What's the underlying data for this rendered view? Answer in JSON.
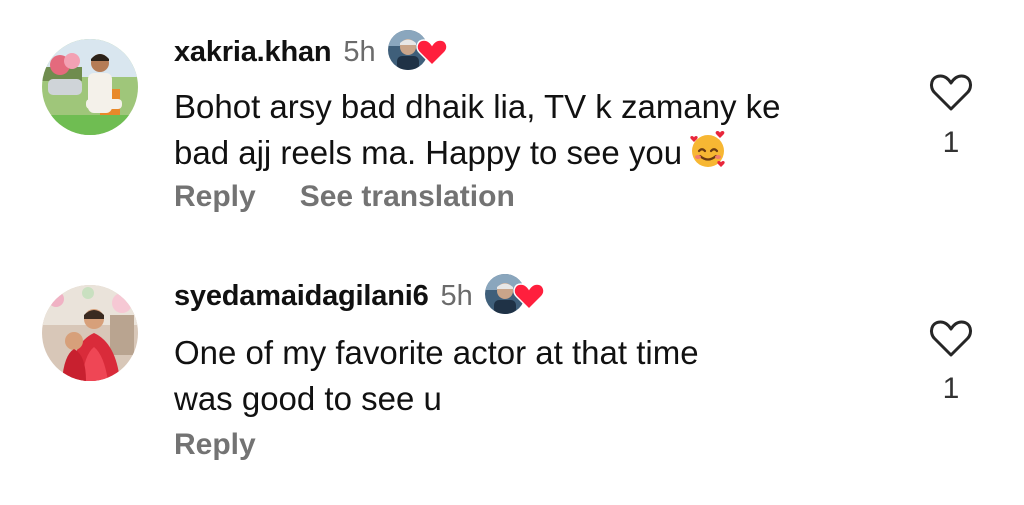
{
  "comments": [
    {
      "username": "xakria.khan",
      "time": "5h",
      "text_line1": "Bohot arsy bad dhaik lia, TV k zamany ke",
      "text_line2": "bad ajj reels ma. Happy to see you",
      "emoji": "smiling-face-with-hearts-icon",
      "actions": [
        "Reply",
        "See translation"
      ],
      "like_count": "1",
      "creator_liked": true
    },
    {
      "username": "syedamaidagilani6",
      "time": "5h",
      "text_line1": "One of my favorite actor at that time",
      "text_line2": "was good to see u",
      "actions": [
        "Reply"
      ],
      "like_count": "1",
      "creator_liked": true
    }
  ],
  "colors": {
    "text": "#111111",
    "secondary": "#737373",
    "heart_red": "#ff1f3d"
  }
}
